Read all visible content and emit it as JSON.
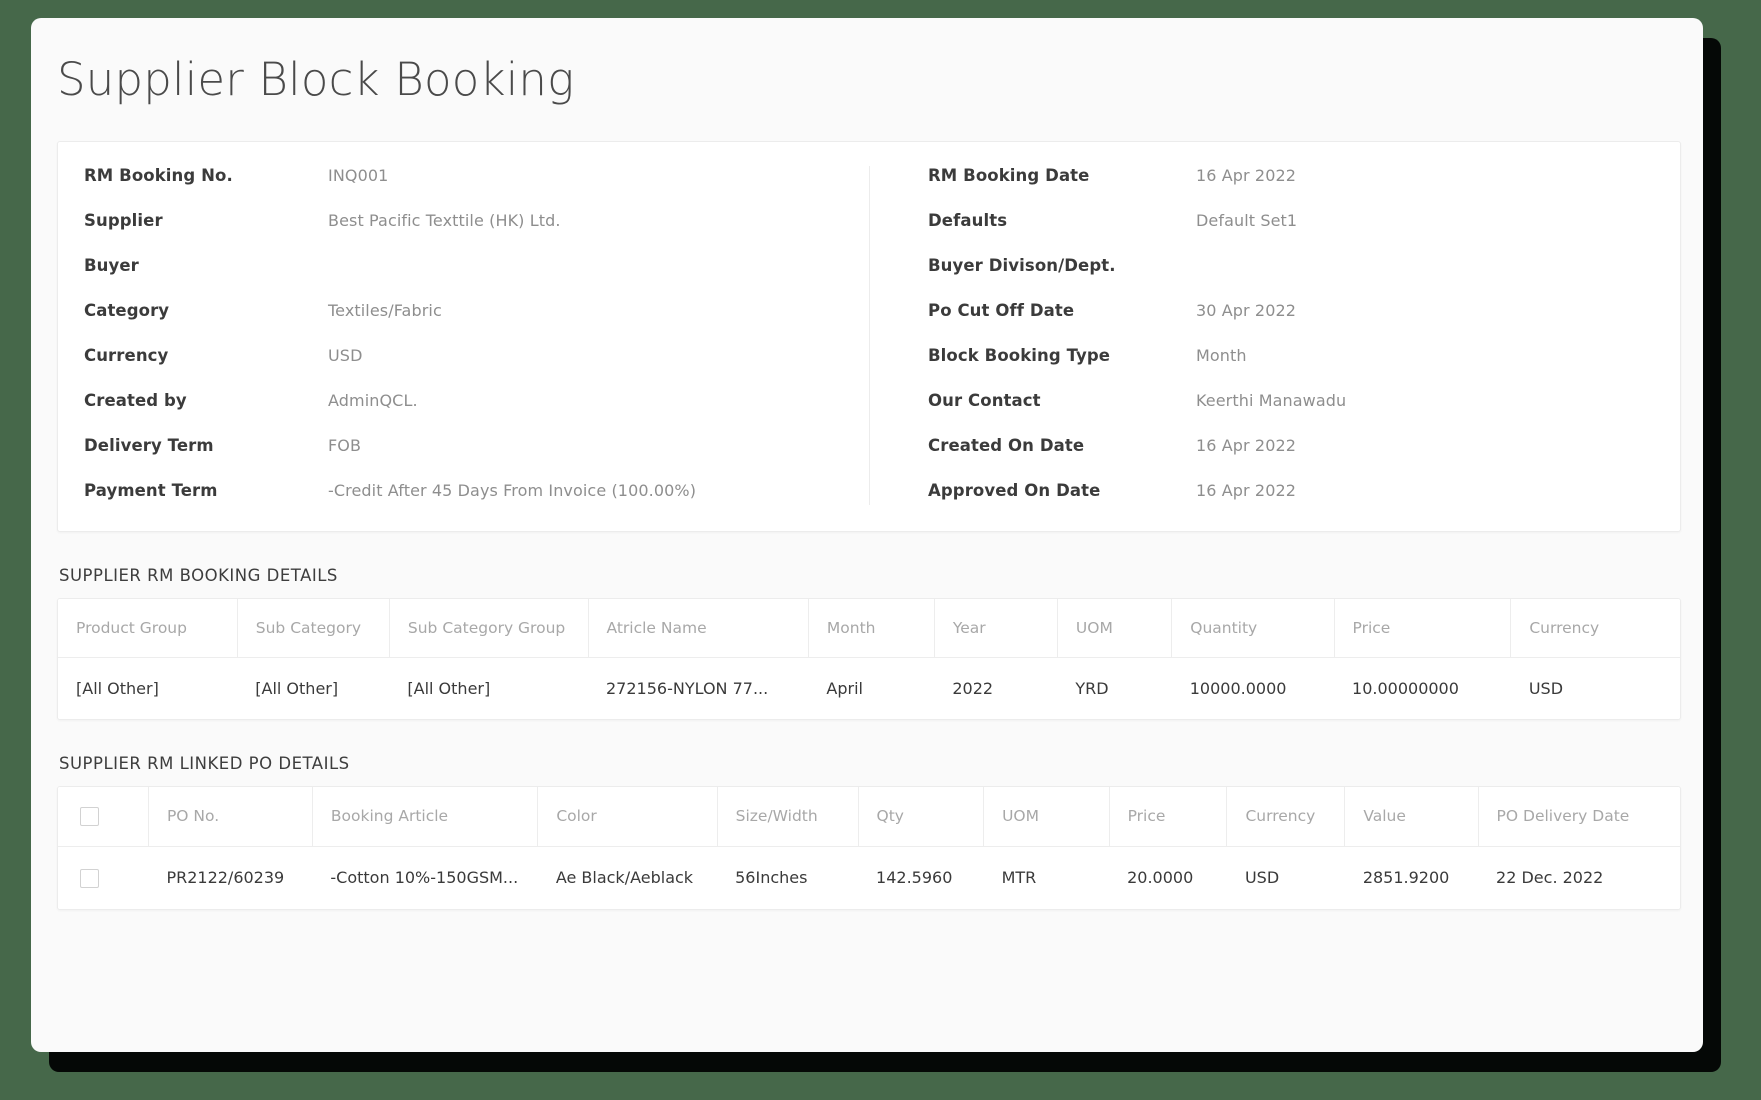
{
  "page": {
    "title": "Supplier Block Booking"
  },
  "info": {
    "left": [
      {
        "label": "RM Booking No.",
        "value": "INQ001"
      },
      {
        "label": "Supplier",
        "value": "Best Pacific Texttile (HK) Ltd."
      },
      {
        "label": "Buyer",
        "value": ""
      },
      {
        "label": "Category",
        "value": "Textiles/Fabric"
      },
      {
        "label": "Currency",
        "value": "USD"
      },
      {
        "label": "Created by",
        "value": "AdminQCL."
      },
      {
        "label": "Delivery Term",
        "value": "FOB"
      },
      {
        "label": "Payment Term",
        "value": "-Credit After 45 Days From Invoice (100.00%)"
      }
    ],
    "right": [
      {
        "label": "RM Booking Date",
        "value": "16 Apr 2022"
      },
      {
        "label": "Defaults",
        "value": "Default Set1"
      },
      {
        "label": "Buyer Divison/Dept.",
        "value": ""
      },
      {
        "label": "Po Cut Off Date",
        "value": "30 Apr 2022"
      },
      {
        "label": "Block Booking Type",
        "value": "Month"
      },
      {
        "label": "Our Contact",
        "value": "Keerthi Manawadu"
      },
      {
        "label": "Created On Date",
        "value": "16 Apr 2022"
      },
      {
        "label": "Approved On Date",
        "value": "16 Apr 2022"
      }
    ]
  },
  "booking_details": {
    "section_title": "SUPPLIER RM BOOKING DETAILS",
    "columns": [
      "Product Group",
      "Sub Category",
      "Sub Category Group",
      "Atricle Name",
      "Month",
      "Year",
      "UOM",
      "Quantity",
      "Price",
      "Currency"
    ],
    "rows": [
      [
        "[All Other]",
        "[All Other]",
        "[All Other]",
        "272156-NYLON 77...",
        "April",
        "2022",
        "YRD",
        "10000.0000",
        "10.00000000",
        "USD"
      ]
    ]
  },
  "linked_po_details": {
    "section_title": "SUPPLIER RM LINKED PO DETAILS",
    "columns": [
      "",
      "PO No.",
      "Booking Article",
      "Color",
      "Size/Width",
      "Qty",
      "UOM",
      "Price",
      "Currency",
      "Value",
      "PO Delivery Date"
    ],
    "rows": [
      [
        "",
        "PR2122/60239",
        "-Cotton 10%-150GSM...",
        "Ae Black/Aeblack",
        "56Inches",
        "142.5960",
        "MTR",
        "20.0000",
        "USD",
        "2851.9200",
        "22 Dec. 2022"
      ]
    ]
  },
  "colors": {
    "page_background": "#fafafa",
    "card_background": "#ffffff",
    "label_text": "#3b3b3b",
    "value_text": "#8e8e8e",
    "header_text": "#a8a8a8",
    "border": "#ececec"
  }
}
